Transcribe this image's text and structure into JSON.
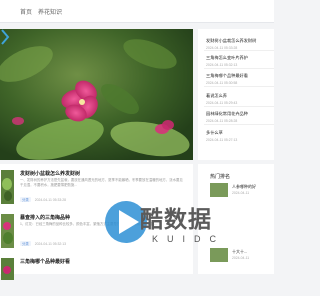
{
  "nav": {
    "items": [
      "首页",
      "养花知识"
    ]
  },
  "slider": {
    "alt_shape": "pink-flower-photo"
  },
  "sidebar": {
    "items": [
      {
        "title": "发财树小盆栽怎么养发财树",
        "meta": "2024-04-11 05:33:28"
      },
      {
        "title": "三角梅怎么变叶片养护",
        "meta": "2024-04-11 05:32:13"
      },
      {
        "title": "三角梅哪个品种最好看",
        "meta": "2024-04-11 05:30:58"
      },
      {
        "title": "着说怎么养",
        "meta": "2024-04-11 05:29:43"
      },
      {
        "title": "园林绿化常用花卉品种",
        "meta": "2024-04-11 05:28:28"
      },
      {
        "title": "多什么草",
        "meta": "2024-04-11 05:27:13"
      }
    ]
  },
  "articles": [
    {
      "title": "发财树小盆栽怎么养发财树",
      "body": "一、发财树的养护方法是先盆栽，要放在通风透光的地方，夏季不能暴晒，冬季要放在温暖的地方，浇水要见干见湿，不要积水，施肥要薄肥勤施...",
      "tag": "分类",
      "meta": "2024-04-11 05:33:28"
    },
    {
      "title": "暴查排入的三角梅品种",
      "body": "1、红花：已经三角梅的品种比较多，颜色丰富，繁殖方式主要是扦插等，可以用枝条扦插...",
      "tag": "分类",
      "meta": "2024-04-11 05:32:13"
    },
    {
      "title": "三角梅哪个品种最好看",
      "body": "",
      "tag": "",
      "meta": ""
    }
  ],
  "hot": {
    "title": "热门排名",
    "items": [
      {
        "title": "人参哪种的好",
        "meta": "2024-04-11"
      },
      {
        "title": "十大十...",
        "meta": "2024-04-11"
      }
    ]
  },
  "watermark": {
    "text": "酷数据",
    "sub": "KUIDC"
  },
  "colors": {
    "accent": "#5a8fd8",
    "flower": "#d6337a",
    "leaf": "#4f7f2e",
    "watermark": "#5b5b5b"
  }
}
